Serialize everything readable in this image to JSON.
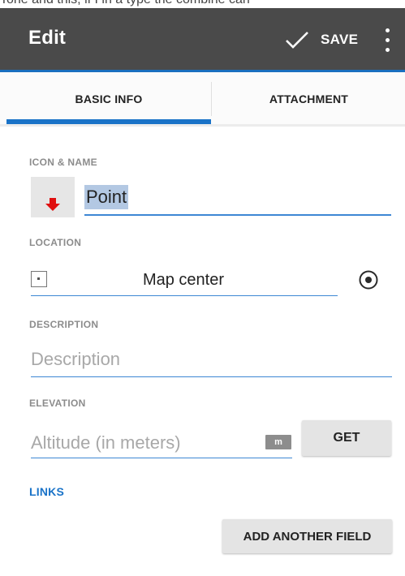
{
  "top_text": "Tone and this, if I in a type the combine can",
  "header": {
    "title": "Edit",
    "save_label": "SAVE"
  },
  "tabs": {
    "basic": "BASIC INFO",
    "attachment": "ATTACHMENT",
    "active": "BASIC INFO"
  },
  "icon_name": {
    "label": "ICON & NAME",
    "name_value": "Point",
    "icon": "red-arrow-down-icon"
  },
  "location": {
    "label": "LOCATION",
    "value": "Map center"
  },
  "description": {
    "label": "DESCRIPTION",
    "placeholder": "Description"
  },
  "elevation": {
    "label": "ELEVATION",
    "placeholder": "Altitude (in meters)",
    "unit": "m",
    "get_label": "GET"
  },
  "links": {
    "label": "LINKS"
  },
  "footer": {
    "add_field_label": "ADD ANOTHER FIELD"
  },
  "colors": {
    "toolbar": "#4a4a4a",
    "accent": "#1a73c8",
    "icon_red": "#e01010",
    "selection": "#b3c8e3"
  }
}
